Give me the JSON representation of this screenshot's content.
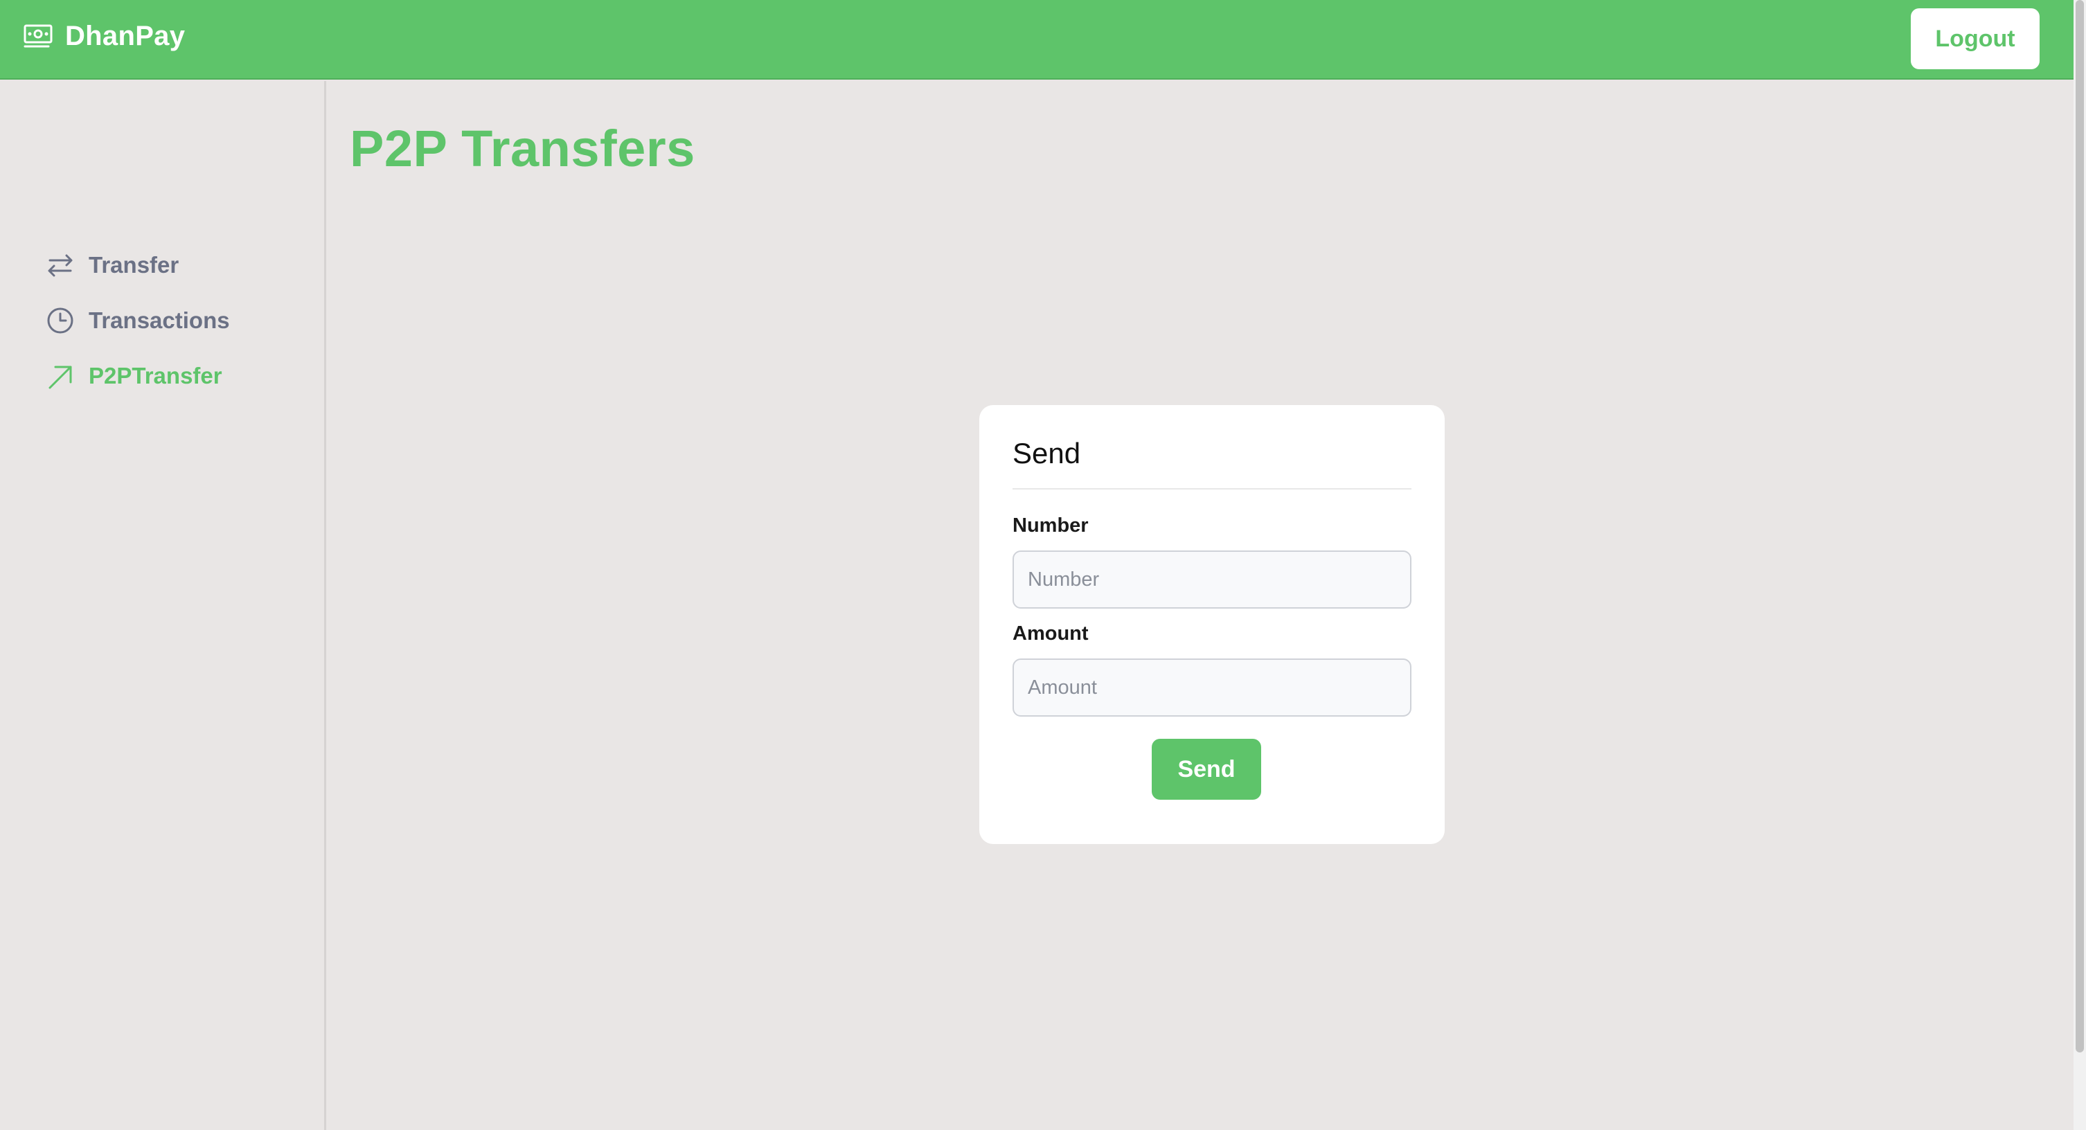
{
  "header": {
    "brand_name": "DhanPay",
    "brand_icon": "banknote-icon",
    "logout_label": "Logout"
  },
  "sidebar": {
    "items": [
      {
        "label": "Transfer",
        "icon": "arrows-left-right-icon",
        "active": false
      },
      {
        "label": "Transactions",
        "icon": "clock-icon",
        "active": false
      },
      {
        "label": "P2PTransfer",
        "icon": "arrow-up-right-icon",
        "active": true
      }
    ]
  },
  "main": {
    "title": "P2P Transfers",
    "card": {
      "title": "Send",
      "number_label": "Number",
      "number_placeholder": "Number",
      "amount_label": "Amount",
      "amount_placeholder": "Amount",
      "send_label": "Send"
    }
  },
  "colors": {
    "brand_green": "#5ec46a",
    "background": "#e9e6e5",
    "nav_inactive": "#6b7185"
  }
}
